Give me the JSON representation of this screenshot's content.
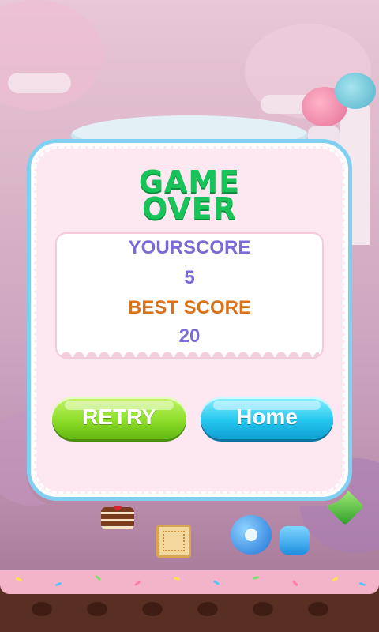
{
  "title": {
    "line1": "GAME",
    "line2": "OVER"
  },
  "score": {
    "your_label": "YOURSCORE",
    "your_value": "5",
    "best_label": "BEST SCORE",
    "best_value": "20"
  },
  "buttons": {
    "retry": "RETRY",
    "home": "Home"
  },
  "colors": {
    "title": "#18c45a",
    "your_score": "#7b6ad8",
    "best_score": "#d9731b",
    "retry": "#8ede2a",
    "home": "#26c8ef",
    "panel_border": "#7fd0f3"
  },
  "icons": [
    "cake-slice-icon",
    "biscuit-icon",
    "green-candy-icon",
    "blue-bomb-candy-icon",
    "blue-jelly-candy-icon"
  ]
}
